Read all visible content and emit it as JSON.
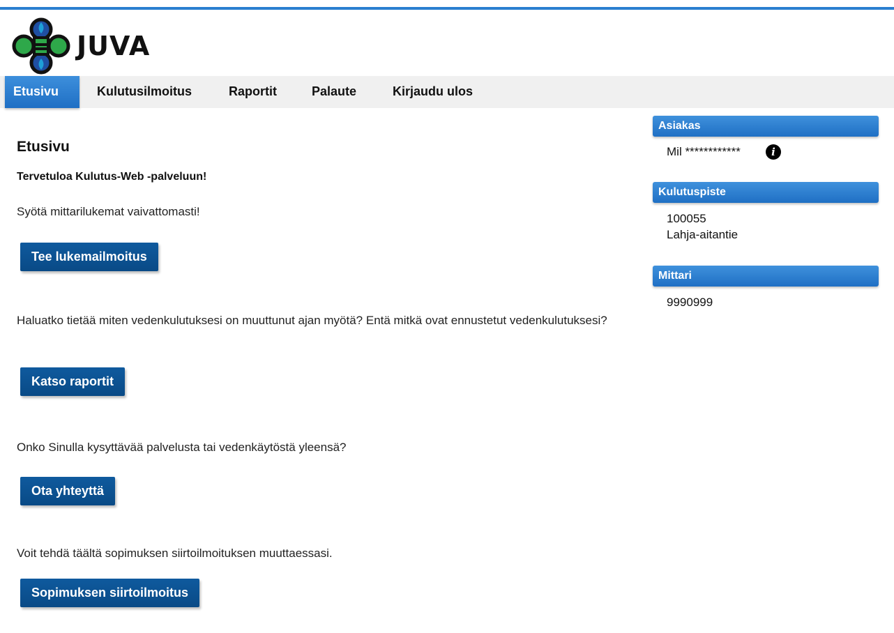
{
  "brand": {
    "name": "JUVA"
  },
  "nav": {
    "items": [
      {
        "label": "Etusivu",
        "active": true
      },
      {
        "label": "Kulutusilmoitus"
      },
      {
        "label": "Raportit"
      },
      {
        "label": "Palaute"
      },
      {
        "label": "Kirjaudu ulos"
      }
    ]
  },
  "main": {
    "title": "Etusivu",
    "welcome": "Tervetuloa Kulutus-Web -palveluun!",
    "sections": [
      {
        "text": "Syötä mittarilukemat vaivattomasti!",
        "button": "Tee lukemailmoitus"
      },
      {
        "text": "Haluatko tietää miten vedenkulutuksesi on muuttunut ajan myötä? Entä mitkä ovat ennustetut vedenkulutuksesi?",
        "button": "Katso raportit"
      },
      {
        "text": "Onko Sinulla kysyttävää palvelusta tai vedenkäytöstä yleensä?",
        "button": "Ota yhteyttä"
      },
      {
        "text": "Voit tehdä täältä sopimuksen siirtoilmoituksen muuttaessasi.",
        "button": "Sopimuksen siirtoilmoitus"
      }
    ]
  },
  "sidebar": {
    "customer": {
      "heading": "Asiakas",
      "name": "Mil ************"
    },
    "consumption_point": {
      "heading": "Kulutuspiste",
      "id": "100055",
      "address": "Lahja-aitantie"
    },
    "meter": {
      "heading": "Mittari",
      "number": "9990999"
    }
  },
  "colors": {
    "accent": "#1f6fc4",
    "button": "#0f5a9e",
    "topline": "#2a7fd0"
  },
  "icons": {
    "info": "info-icon",
    "logo": "juva-logo-icon"
  }
}
